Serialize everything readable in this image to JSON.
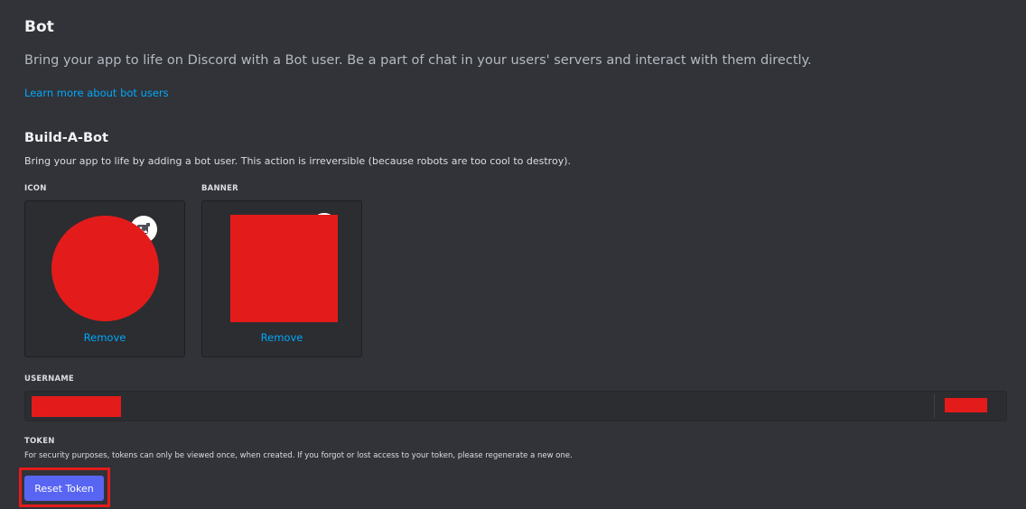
{
  "header": {
    "title": "Bot",
    "subtitle": "Bring your app to life on Discord with a Bot user. Be a part of chat in your users' servers and interact with them directly.",
    "learn_more_link": "Learn more about bot users"
  },
  "build_a_bot": {
    "title": "Build-A-Bot",
    "description": "Bring your app to life by adding a bot user. This action is irreversible (because robots are too cool to destroy).",
    "icon": {
      "label": "ICON",
      "remove_label": "Remove",
      "edit_icon": "image-edit-icon",
      "redaction_color": "#e41b1b"
    },
    "banner": {
      "label": "BANNER",
      "remove_label": "Remove",
      "edit_icon": "image-edit-icon",
      "redaction_color": "#e41b1b"
    }
  },
  "username": {
    "label": "USERNAME",
    "value_redacted": true,
    "discriminator_redacted": true
  },
  "token": {
    "label": "TOKEN",
    "description": "For security purposes, tokens can only be viewed once, when created. If you forgot or lost access to your token, please regenerate a new one.",
    "reset_button_label": "Reset Token"
  },
  "colors": {
    "background": "#313338",
    "accent": "#5865f2",
    "link": "#00a8fc",
    "redaction": "#e41b1b"
  }
}
